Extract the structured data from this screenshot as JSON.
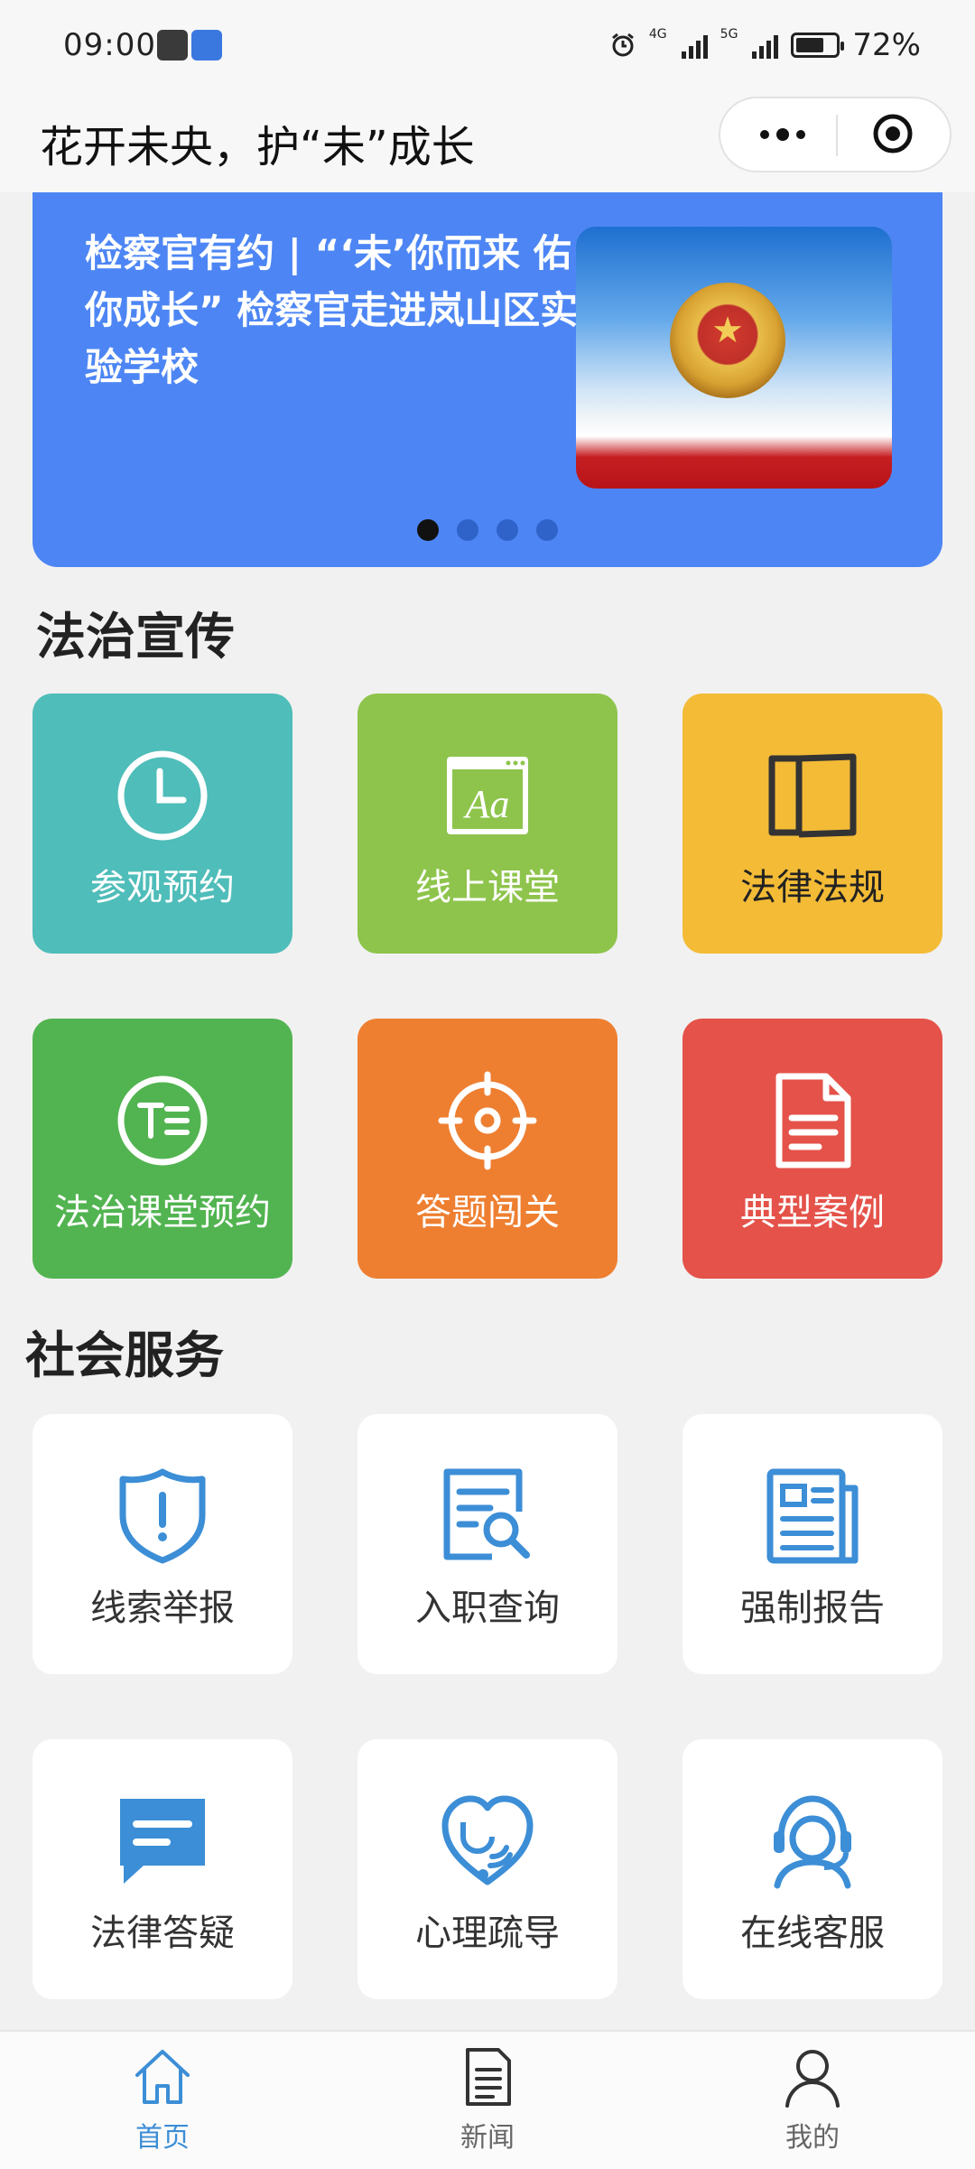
{
  "status_bar": {
    "time": "09:00",
    "signal_labels": [
      "4G",
      "5G"
    ],
    "battery_percent": "72%",
    "battery_level": 0.72
  },
  "titlebar": {
    "title": "花开未央，护“未”成长"
  },
  "banner": {
    "headline": "检察官有约 | “‘未’你而来 佑你成长” 检察官走进岚山区实验学校",
    "page_count": 4,
    "active_page": 0
  },
  "sections": {
    "legal_promotion": {
      "title": "法治宣传",
      "items": [
        {
          "label": "参观预约",
          "icon": "clock-icon",
          "color": "#4fbdb9"
        },
        {
          "label": "线上课堂",
          "icon": "font-window-icon",
          "color": "#8ec44c"
        },
        {
          "label": "法律法规",
          "icon": "open-book-icon",
          "color": "#f3bb36"
        },
        {
          "label": "法治课堂预约",
          "icon": "text-circle-icon",
          "color": "#52b451"
        },
        {
          "label": "答题闯关",
          "icon": "crosshair-icon",
          "color": "#ee7f31"
        },
        {
          "label": "典型案例",
          "icon": "document-icon",
          "color": "#e45249"
        }
      ]
    },
    "social_service": {
      "title": "社会服务",
      "items": [
        {
          "label": "线索举报",
          "icon": "shield-alert-icon"
        },
        {
          "label": "入职查询",
          "icon": "document-search-icon"
        },
        {
          "label": "强制报告",
          "icon": "newspaper-icon"
        },
        {
          "label": "法律答疑",
          "icon": "chat-bubble-icon"
        },
        {
          "label": "心理疏导",
          "icon": "heart-stethoscope-icon"
        },
        {
          "label": "在线客服",
          "icon": "headset-agent-icon"
        }
      ]
    }
  },
  "bottom_nav": {
    "items": [
      {
        "label": "首页",
        "icon": "home-icon",
        "active": true
      },
      {
        "label": "新闻",
        "icon": "news-icon",
        "active": false
      },
      {
        "label": "我的",
        "icon": "user-icon",
        "active": false
      }
    ]
  },
  "colors": {
    "accent_blue": "#3c8ed6",
    "banner_blue": "#4d86f4"
  }
}
